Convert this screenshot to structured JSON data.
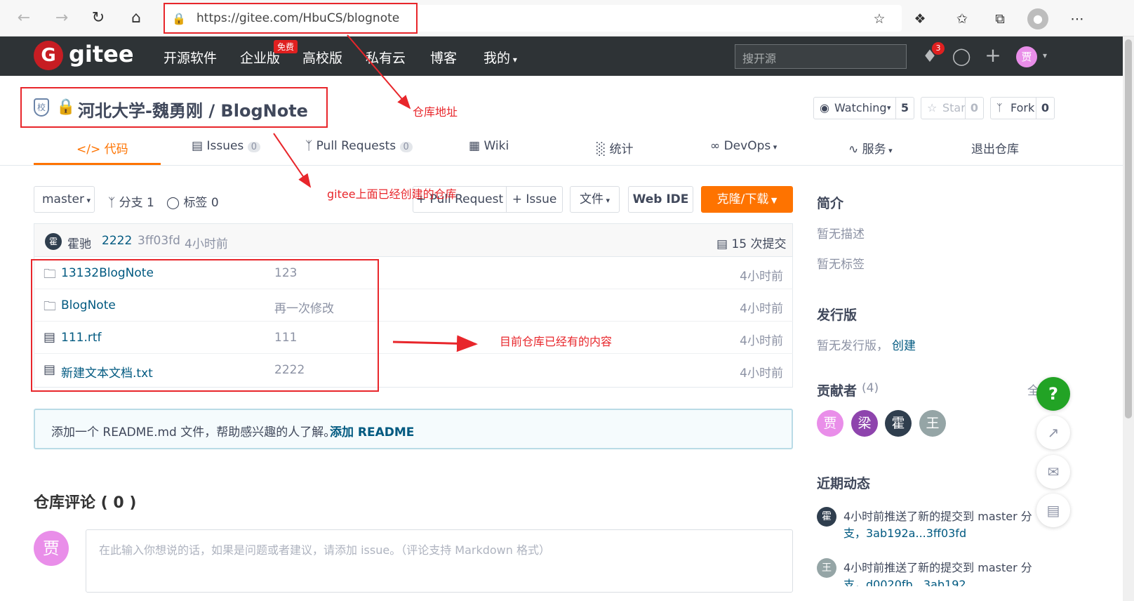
{
  "browser": {
    "url": "https://gitee.com/HbuCS/blognote",
    "back_icon": "arrow-left-icon",
    "forward_icon": "arrow-right-icon"
  },
  "header": {
    "logo_letter": "G",
    "logo_text": "gitee",
    "nav": [
      "开源软件",
      "企业版",
      "高校版",
      "私有云",
      "博客",
      "我的"
    ],
    "free_badge": "免费",
    "search_placeholder": "搜开源",
    "notif_count": "3",
    "user_avatar": "贾"
  },
  "repo": {
    "badge": "校",
    "title": "河北大学-魏勇刚 / BlogNote",
    "watching_label": "Watching",
    "watching_count": "5",
    "star_label": "Star",
    "star_count": "0",
    "fork_label": "Fork",
    "fork_count": "0"
  },
  "tabs": [
    {
      "label": "代码",
      "count": ""
    },
    {
      "label": "Issues",
      "count": "0"
    },
    {
      "label": "Pull Requests",
      "count": "0"
    },
    {
      "label": "Wiki",
      "count": ""
    },
    {
      "label": "统计",
      "count": ""
    },
    {
      "label": "DevOps",
      "count": ""
    },
    {
      "label": "服务",
      "count": ""
    },
    {
      "label": "退出仓库",
      "count": ""
    }
  ],
  "toolbar": {
    "branch": "master",
    "branches": "分支 1",
    "tags": "标签 0",
    "pull_request": "+ Pull Request",
    "issue": "+ Issue",
    "files": "文件",
    "web_ide": "Web IDE",
    "clone": "克隆/下载"
  },
  "commit": {
    "avatar": "霍",
    "author": "霍驰",
    "message": "2222",
    "hash": "3ff03fd",
    "time": "4小时前",
    "total": "15 次提交"
  },
  "files": [
    {
      "name": "13132BlogNote",
      "type": "folder",
      "msg": "123",
      "time": "4小时前"
    },
    {
      "name": "BlogNote",
      "type": "folder",
      "msg": "再一次修改",
      "time": "4小时前"
    },
    {
      "name": "111.rtf",
      "type": "file",
      "msg": "111",
      "time": "4小时前"
    },
    {
      "name": "新建文本文档.txt",
      "type": "file",
      "msg": "2222",
      "time": "4小时前"
    }
  ],
  "readme": {
    "text": "添加一个 README.md 文件，帮助感兴趣的人了解。",
    "link": "添加 README"
  },
  "comments": {
    "title": "仓库评论 ( 0 )",
    "avatar": "贾",
    "placeholder": "在此输入你想说的话，如果是问题或者建议，请添加 issue。（评论支持 Markdown 格式）"
  },
  "sidebar": {
    "intro_title": "简介",
    "no_desc": "暂无描述",
    "no_tags": "暂无标签",
    "release_title": "发行版",
    "no_release": "暂无发行版，",
    "create_link": "创建",
    "contrib_title": "贡献者",
    "contrib_count": "(4)",
    "all_link": "全",
    "contributors": [
      "贾",
      "梁",
      "霍",
      "王"
    ],
    "activity_title": "近期动态",
    "activities": [
      {
        "avatar": "霍",
        "line1": "4小时前推送了新的提交到 master 分",
        "line2": "支，3ab192a...3ff03fd"
      },
      {
        "avatar": "王",
        "line1": "4小时前推送了新的提交到 master 分",
        "line2": "支，d0020fb...3ab192"
      }
    ]
  },
  "annotations": {
    "repo_addr": "仓库地址",
    "created_repo": "gitee上面已经创建的仓库",
    "contents": "目前仓库已经有的内容"
  },
  "colors": {
    "accent": "#fe7300",
    "annotation": "#e8262b",
    "header_bg": "#2e3336",
    "link": "#005980"
  }
}
